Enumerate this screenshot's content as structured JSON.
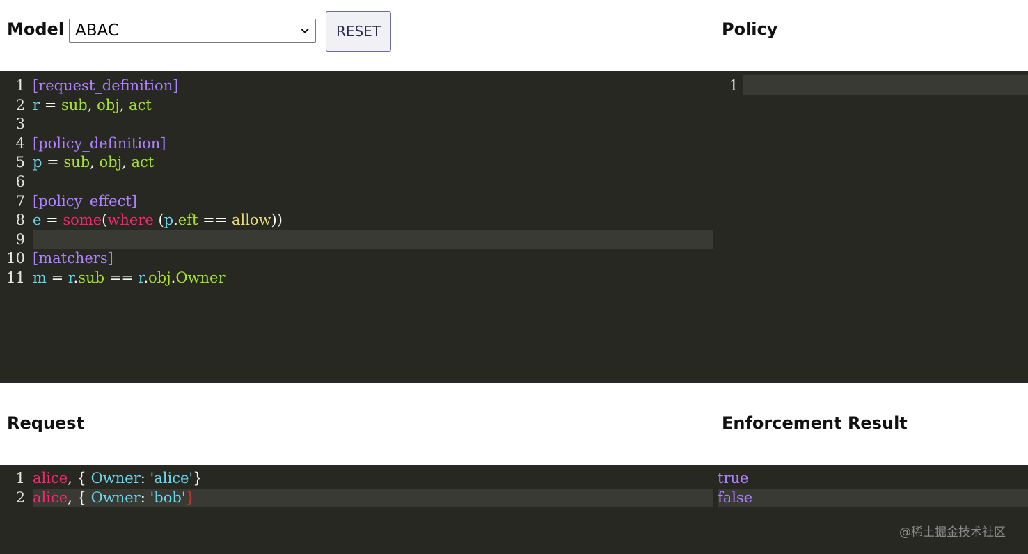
{
  "header": {
    "model_label": "Model",
    "model_selected": "ABAC",
    "reset_label": "RESET",
    "policy_title": "Policy"
  },
  "model_editor": {
    "line_numbers": [
      "1",
      "2",
      "3",
      "4",
      "5",
      "6",
      "7",
      "8",
      "9",
      "10",
      "11"
    ],
    "lines": [
      [
        {
          "t": "[request_definition]",
          "c": "section"
        }
      ],
      [
        {
          "t": "r",
          "c": "var"
        },
        {
          "t": " = ",
          "c": "eq"
        },
        {
          "t": "sub",
          "c": "attr"
        },
        {
          "t": ", ",
          "c": "punct"
        },
        {
          "t": "obj",
          "c": "attr"
        },
        {
          "t": ", ",
          "c": "punct"
        },
        {
          "t": "act",
          "c": "attr"
        }
      ],
      [],
      [
        {
          "t": "[policy_definition]",
          "c": "section"
        }
      ],
      [
        {
          "t": "p",
          "c": "var"
        },
        {
          "t": " = ",
          "c": "eq"
        },
        {
          "t": "sub",
          "c": "attr"
        },
        {
          "t": ", ",
          "c": "punct"
        },
        {
          "t": "obj",
          "c": "attr"
        },
        {
          "t": ", ",
          "c": "punct"
        },
        {
          "t": "act",
          "c": "attr"
        }
      ],
      [],
      [
        {
          "t": "[policy_effect]",
          "c": "section"
        }
      ],
      [
        {
          "t": "e",
          "c": "var"
        },
        {
          "t": " = ",
          "c": "eq"
        },
        {
          "t": "some",
          "c": "func"
        },
        {
          "t": "(",
          "c": "punct"
        },
        {
          "t": "where",
          "c": "kw"
        },
        {
          "t": " (",
          "c": "punct"
        },
        {
          "t": "p",
          "c": "var"
        },
        {
          "t": ".",
          "c": "punct"
        },
        {
          "t": "eft",
          "c": "attr"
        },
        {
          "t": " == ",
          "c": "eq"
        },
        {
          "t": "allow",
          "c": "str"
        },
        {
          "t": "))",
          "c": "punct"
        }
      ],
      [],
      [
        {
          "t": "[matchers]",
          "c": "section"
        }
      ],
      [
        {
          "t": "m",
          "c": "var"
        },
        {
          "t": " = ",
          "c": "eq"
        },
        {
          "t": "r",
          "c": "var"
        },
        {
          "t": ".",
          "c": "punct"
        },
        {
          "t": "sub",
          "c": "attr"
        },
        {
          "t": " == ",
          "c": "eq"
        },
        {
          "t": "r",
          "c": "var"
        },
        {
          "t": ".",
          "c": "punct"
        },
        {
          "t": "obj",
          "c": "attr"
        },
        {
          "t": ".",
          "c": "punct"
        },
        {
          "t": "Owner",
          "c": "attr"
        }
      ]
    ],
    "active_line": 9
  },
  "policy_editor": {
    "line_numbers": [
      "1"
    ]
  },
  "request_title": "Request",
  "request_editor": {
    "line_numbers": [
      "1",
      "2"
    ],
    "lines": [
      [
        {
          "t": "alice",
          "c": "func"
        },
        {
          "t": ", ",
          "c": "punct"
        },
        {
          "t": "{ ",
          "c": "brace"
        },
        {
          "t": "Owner",
          "c": "prop"
        },
        {
          "t": ": ",
          "c": "punct"
        },
        {
          "t": "'alice'",
          "c": "prop"
        },
        {
          "t": "}",
          "c": "brace"
        }
      ],
      [
        {
          "t": "alice",
          "c": "func"
        },
        {
          "t": ", ",
          "c": "punct"
        },
        {
          "t": "{ ",
          "c": "brace"
        },
        {
          "t": "Owner",
          "c": "prop"
        },
        {
          "t": ": ",
          "c": "punct"
        },
        {
          "t": "'bob'",
          "c": "prop"
        },
        {
          "t": "}",
          "c": "brace-err"
        }
      ]
    ],
    "active_line": 2
  },
  "result_title": "Enforcement Result",
  "result_editor": {
    "lines": [
      "true",
      "false"
    ],
    "active_line": 2
  },
  "watermark": "@稀土掘金技术社区"
}
